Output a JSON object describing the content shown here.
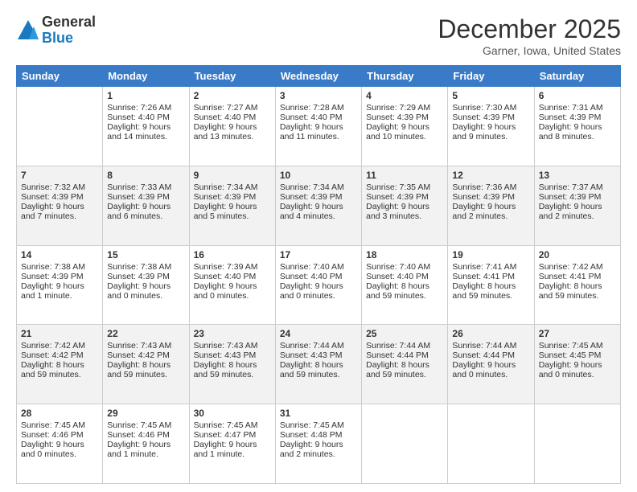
{
  "logo": {
    "general": "General",
    "blue": "Blue"
  },
  "title": "December 2025",
  "location": "Garner, Iowa, United States",
  "days_of_week": [
    "Sunday",
    "Monday",
    "Tuesday",
    "Wednesday",
    "Thursday",
    "Friday",
    "Saturday"
  ],
  "weeks": [
    [
      {
        "day": "",
        "sunrise": "",
        "sunset": "",
        "daylight": ""
      },
      {
        "day": "1",
        "sunrise": "Sunrise: 7:26 AM",
        "sunset": "Sunset: 4:40 PM",
        "daylight": "Daylight: 9 hours and 14 minutes."
      },
      {
        "day": "2",
        "sunrise": "Sunrise: 7:27 AM",
        "sunset": "Sunset: 4:40 PM",
        "daylight": "Daylight: 9 hours and 13 minutes."
      },
      {
        "day": "3",
        "sunrise": "Sunrise: 7:28 AM",
        "sunset": "Sunset: 4:40 PM",
        "daylight": "Daylight: 9 hours and 11 minutes."
      },
      {
        "day": "4",
        "sunrise": "Sunrise: 7:29 AM",
        "sunset": "Sunset: 4:39 PM",
        "daylight": "Daylight: 9 hours and 10 minutes."
      },
      {
        "day": "5",
        "sunrise": "Sunrise: 7:30 AM",
        "sunset": "Sunset: 4:39 PM",
        "daylight": "Daylight: 9 hours and 9 minutes."
      },
      {
        "day": "6",
        "sunrise": "Sunrise: 7:31 AM",
        "sunset": "Sunset: 4:39 PM",
        "daylight": "Daylight: 9 hours and 8 minutes."
      }
    ],
    [
      {
        "day": "7",
        "sunrise": "Sunrise: 7:32 AM",
        "sunset": "Sunset: 4:39 PM",
        "daylight": "Daylight: 9 hours and 7 minutes."
      },
      {
        "day": "8",
        "sunrise": "Sunrise: 7:33 AM",
        "sunset": "Sunset: 4:39 PM",
        "daylight": "Daylight: 9 hours and 6 minutes."
      },
      {
        "day": "9",
        "sunrise": "Sunrise: 7:34 AM",
        "sunset": "Sunset: 4:39 PM",
        "daylight": "Daylight: 9 hours and 5 minutes."
      },
      {
        "day": "10",
        "sunrise": "Sunrise: 7:34 AM",
        "sunset": "Sunset: 4:39 PM",
        "daylight": "Daylight: 9 hours and 4 minutes."
      },
      {
        "day": "11",
        "sunrise": "Sunrise: 7:35 AM",
        "sunset": "Sunset: 4:39 PM",
        "daylight": "Daylight: 9 hours and 3 minutes."
      },
      {
        "day": "12",
        "sunrise": "Sunrise: 7:36 AM",
        "sunset": "Sunset: 4:39 PM",
        "daylight": "Daylight: 9 hours and 2 minutes."
      },
      {
        "day": "13",
        "sunrise": "Sunrise: 7:37 AM",
        "sunset": "Sunset: 4:39 PM",
        "daylight": "Daylight: 9 hours and 2 minutes."
      }
    ],
    [
      {
        "day": "14",
        "sunrise": "Sunrise: 7:38 AM",
        "sunset": "Sunset: 4:39 PM",
        "daylight": "Daylight: 9 hours and 1 minute."
      },
      {
        "day": "15",
        "sunrise": "Sunrise: 7:38 AM",
        "sunset": "Sunset: 4:39 PM",
        "daylight": "Daylight: 9 hours and 0 minutes."
      },
      {
        "day": "16",
        "sunrise": "Sunrise: 7:39 AM",
        "sunset": "Sunset: 4:40 PM",
        "daylight": "Daylight: 9 hours and 0 minutes."
      },
      {
        "day": "17",
        "sunrise": "Sunrise: 7:40 AM",
        "sunset": "Sunset: 4:40 PM",
        "daylight": "Daylight: 9 hours and 0 minutes."
      },
      {
        "day": "18",
        "sunrise": "Sunrise: 7:40 AM",
        "sunset": "Sunset: 4:40 PM",
        "daylight": "Daylight: 8 hours and 59 minutes."
      },
      {
        "day": "19",
        "sunrise": "Sunrise: 7:41 AM",
        "sunset": "Sunset: 4:41 PM",
        "daylight": "Daylight: 8 hours and 59 minutes."
      },
      {
        "day": "20",
        "sunrise": "Sunrise: 7:42 AM",
        "sunset": "Sunset: 4:41 PM",
        "daylight": "Daylight: 8 hours and 59 minutes."
      }
    ],
    [
      {
        "day": "21",
        "sunrise": "Sunrise: 7:42 AM",
        "sunset": "Sunset: 4:42 PM",
        "daylight": "Daylight: 8 hours and 59 minutes."
      },
      {
        "day": "22",
        "sunrise": "Sunrise: 7:43 AM",
        "sunset": "Sunset: 4:42 PM",
        "daylight": "Daylight: 8 hours and 59 minutes."
      },
      {
        "day": "23",
        "sunrise": "Sunrise: 7:43 AM",
        "sunset": "Sunset: 4:43 PM",
        "daylight": "Daylight: 8 hours and 59 minutes."
      },
      {
        "day": "24",
        "sunrise": "Sunrise: 7:44 AM",
        "sunset": "Sunset: 4:43 PM",
        "daylight": "Daylight: 8 hours and 59 minutes."
      },
      {
        "day": "25",
        "sunrise": "Sunrise: 7:44 AM",
        "sunset": "Sunset: 4:44 PM",
        "daylight": "Daylight: 8 hours and 59 minutes."
      },
      {
        "day": "26",
        "sunrise": "Sunrise: 7:44 AM",
        "sunset": "Sunset: 4:44 PM",
        "daylight": "Daylight: 9 hours and 0 minutes."
      },
      {
        "day": "27",
        "sunrise": "Sunrise: 7:45 AM",
        "sunset": "Sunset: 4:45 PM",
        "daylight": "Daylight: 9 hours and 0 minutes."
      }
    ],
    [
      {
        "day": "28",
        "sunrise": "Sunrise: 7:45 AM",
        "sunset": "Sunset: 4:46 PM",
        "daylight": "Daylight: 9 hours and 0 minutes."
      },
      {
        "day": "29",
        "sunrise": "Sunrise: 7:45 AM",
        "sunset": "Sunset: 4:46 PM",
        "daylight": "Daylight: 9 hours and 1 minute."
      },
      {
        "day": "30",
        "sunrise": "Sunrise: 7:45 AM",
        "sunset": "Sunset: 4:47 PM",
        "daylight": "Daylight: 9 hours and 1 minute."
      },
      {
        "day": "31",
        "sunrise": "Sunrise: 7:45 AM",
        "sunset": "Sunset: 4:48 PM",
        "daylight": "Daylight: 9 hours and 2 minutes."
      },
      {
        "day": "",
        "sunrise": "",
        "sunset": "",
        "daylight": ""
      },
      {
        "day": "",
        "sunrise": "",
        "sunset": "",
        "daylight": ""
      },
      {
        "day": "",
        "sunrise": "",
        "sunset": "",
        "daylight": ""
      }
    ]
  ]
}
